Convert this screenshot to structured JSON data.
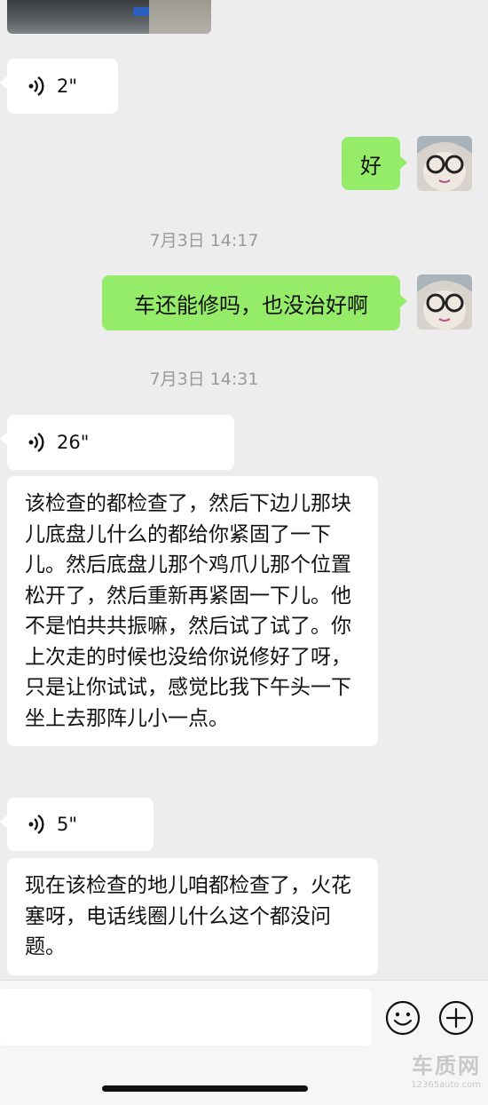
{
  "messages": {
    "voice1": {
      "duration": "2\""
    },
    "reply1": {
      "text": "好"
    },
    "time1": "7月3日 14:17",
    "reply2": {
      "text": "车还能修吗，也没治好啊"
    },
    "time2": "7月3日 14:31",
    "voice2": {
      "duration": "26\""
    },
    "text1": "该检查的都检查了，然后下边儿那块儿底盘儿什么的都给你紧固了一下儿。然后底盘儿那个鸡爪儿那个位置松开了，然后重新再紧固一下儿。他不是怕共共振嘛，然后试了试了。你上次走的时候也没给你说修好了呀，只是让你试试，感觉比我下午头一下坐上去那阵儿小一点。",
    "voice3": {
      "duration": "5\""
    },
    "text2": "现在该检查的地儿咱都检查了，火花塞呀，电话线圈儿什么这个都没问题。"
  },
  "input_bar": {
    "emoji_icon": "smiley-icon",
    "more_icon": "plus-circle-icon"
  },
  "watermark": {
    "brand": "车质网",
    "url": "12365auto.com"
  },
  "colors": {
    "background": "#ededed",
    "incoming_bubble": "#ffffff",
    "outgoing_bubble": "#95ec69",
    "timestamp": "#9a9a9a"
  }
}
